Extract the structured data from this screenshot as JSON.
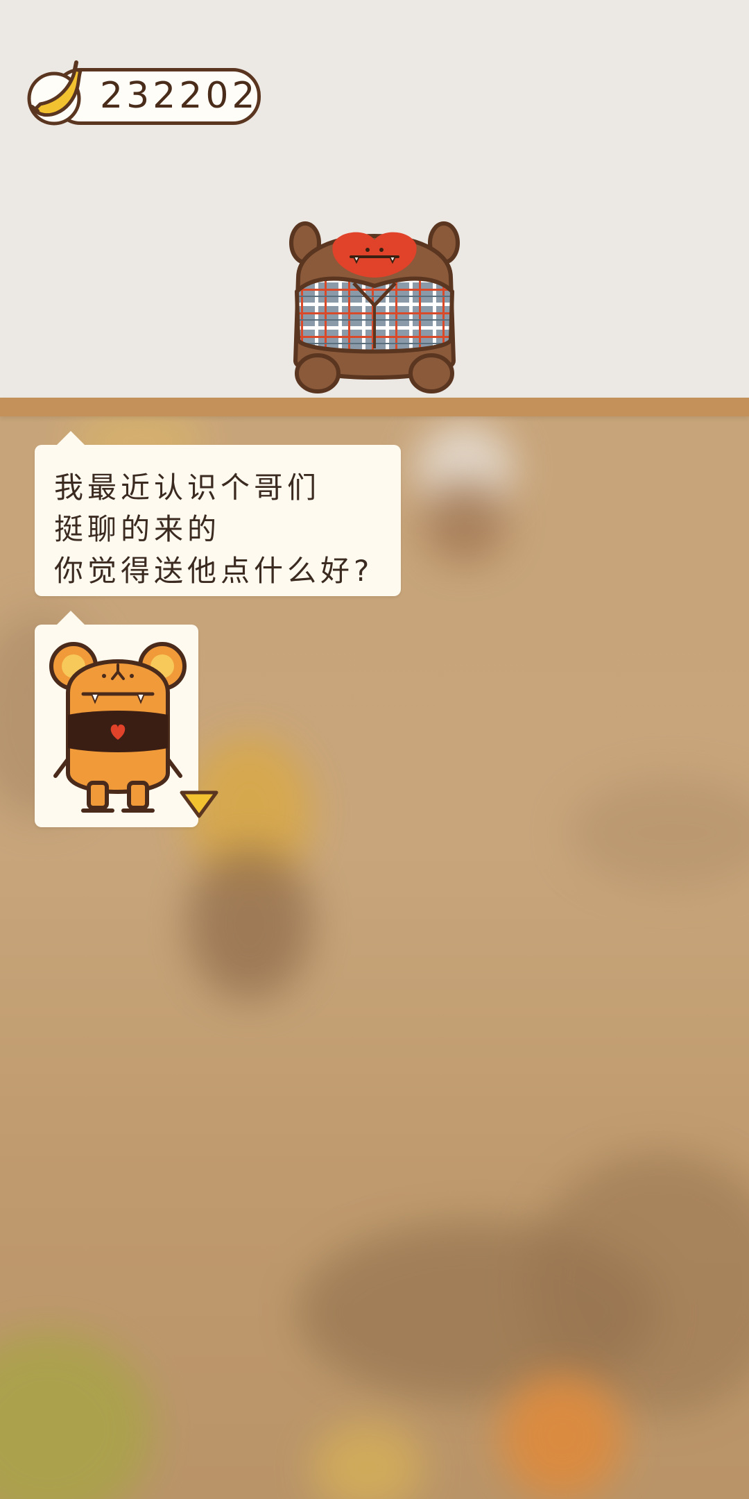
{
  "hud": {
    "banana_count": "232202",
    "banana_icon": "banana-icon"
  },
  "main_character": {
    "icon": "monkey-plaid-shirt-icon"
  },
  "dialogue": {
    "lines": [
      "我最近认识个哥们",
      "挺聊的来的",
      "你觉得送他点什么好?"
    ],
    "sticker_icon": "orange-bear-sticker-icon",
    "next_icon": "triangle-down-icon"
  },
  "colors": {
    "top_background": "#ece8e3",
    "shelf": "#c4915a",
    "scene_background": "#c9a77a",
    "bubble": "#fffaf0",
    "text": "#3a2a20",
    "arrow": "#f2c230"
  }
}
